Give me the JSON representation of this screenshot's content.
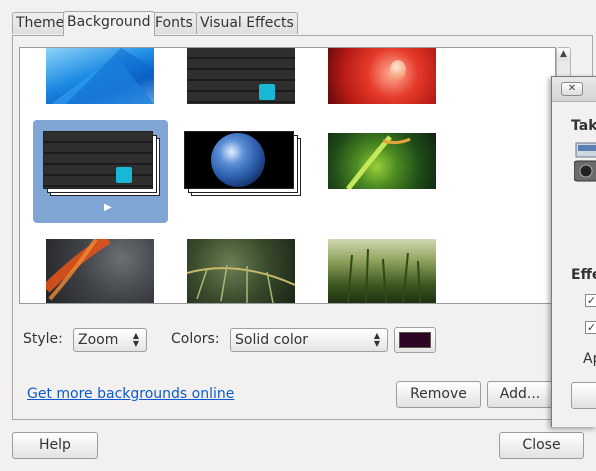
{
  "tabs": [
    {
      "label": "Theme"
    },
    {
      "label": "Background"
    },
    {
      "label": "Fonts"
    },
    {
      "label": "Visual Effects"
    }
  ],
  "active_tab": "Background",
  "gallery": {
    "items": [
      {
        "name": "blue-abstract",
        "selected": false
      },
      {
        "name": "dark-wood-cyan",
        "selected": false
      },
      {
        "name": "red-flower-drop",
        "selected": false
      },
      {
        "name": "dark-wood-cyan-slideshow",
        "selected": true,
        "slideshow": true
      },
      {
        "name": "earth-slideshow",
        "selected": false,
        "slideshow": true
      },
      {
        "name": "green-plant",
        "selected": false
      },
      {
        "name": "orange-feather",
        "selected": false
      },
      {
        "name": "palm-leaf",
        "selected": false
      },
      {
        "name": "wheat-field",
        "selected": false
      }
    ],
    "play_marker": "▶"
  },
  "style": {
    "label": "Style:",
    "value": "Zoom"
  },
  "colors": {
    "label": "Colors:",
    "value": "Solid color",
    "swatch": "#2c0622"
  },
  "link": {
    "text": "Get more backgrounds online"
  },
  "buttons": {
    "remove": "Remove",
    "add": "Add...",
    "help": "Help",
    "close": "Close"
  },
  "overlay_window": {
    "title_fragment": "Take",
    "section_fragment": "Effe",
    "label_fragment": "Ap",
    "close_glyph": "✕"
  }
}
